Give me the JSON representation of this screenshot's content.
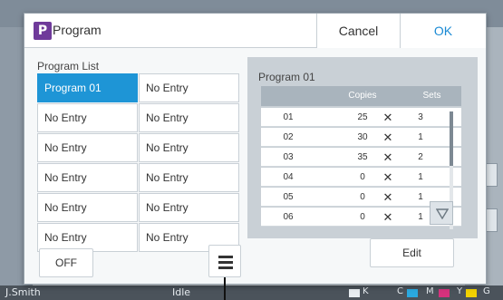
{
  "dialog": {
    "icon_letter": "P",
    "title": "Program",
    "cancel_label": "Cancel",
    "ok_label": "OK"
  },
  "program_list": {
    "label": "Program List",
    "items": [
      "Program 01",
      "No Entry",
      "No Entry",
      "No Entry",
      "No Entry",
      "No Entry",
      "No Entry",
      "No Entry",
      "No Entry",
      "No Entry",
      "No Entry",
      "No Entry"
    ],
    "selected": "Program 01"
  },
  "details": {
    "title": "Program 01",
    "headers": [
      "",
      "Copies",
      "",
      "Sets"
    ],
    "rows": [
      {
        "no": "01",
        "copies": "25",
        "x": "✕",
        "sets": "3"
      },
      {
        "no": "02",
        "copies": "30",
        "x": "✕",
        "sets": "1"
      },
      {
        "no": "03",
        "copies": "35",
        "x": "✕",
        "sets": "2"
      },
      {
        "no": "04",
        "copies": "0",
        "x": "✕",
        "sets": "1"
      },
      {
        "no": "05",
        "copies": "0",
        "x": "✕",
        "sets": "1"
      },
      {
        "no": "06",
        "copies": "0",
        "x": "✕",
        "sets": "1"
      }
    ]
  },
  "buttons": {
    "off_label": "OFF",
    "edit_label": "Edit"
  },
  "status_bar": {
    "user": "J.Smith",
    "state": "Idle",
    "inks": [
      "K",
      "C",
      "M",
      "Y",
      "G"
    ]
  },
  "colors": {
    "accent": "#1e95d6",
    "ok_text": "#1a8ad4",
    "icon_purple": "#6f3a9a"
  }
}
